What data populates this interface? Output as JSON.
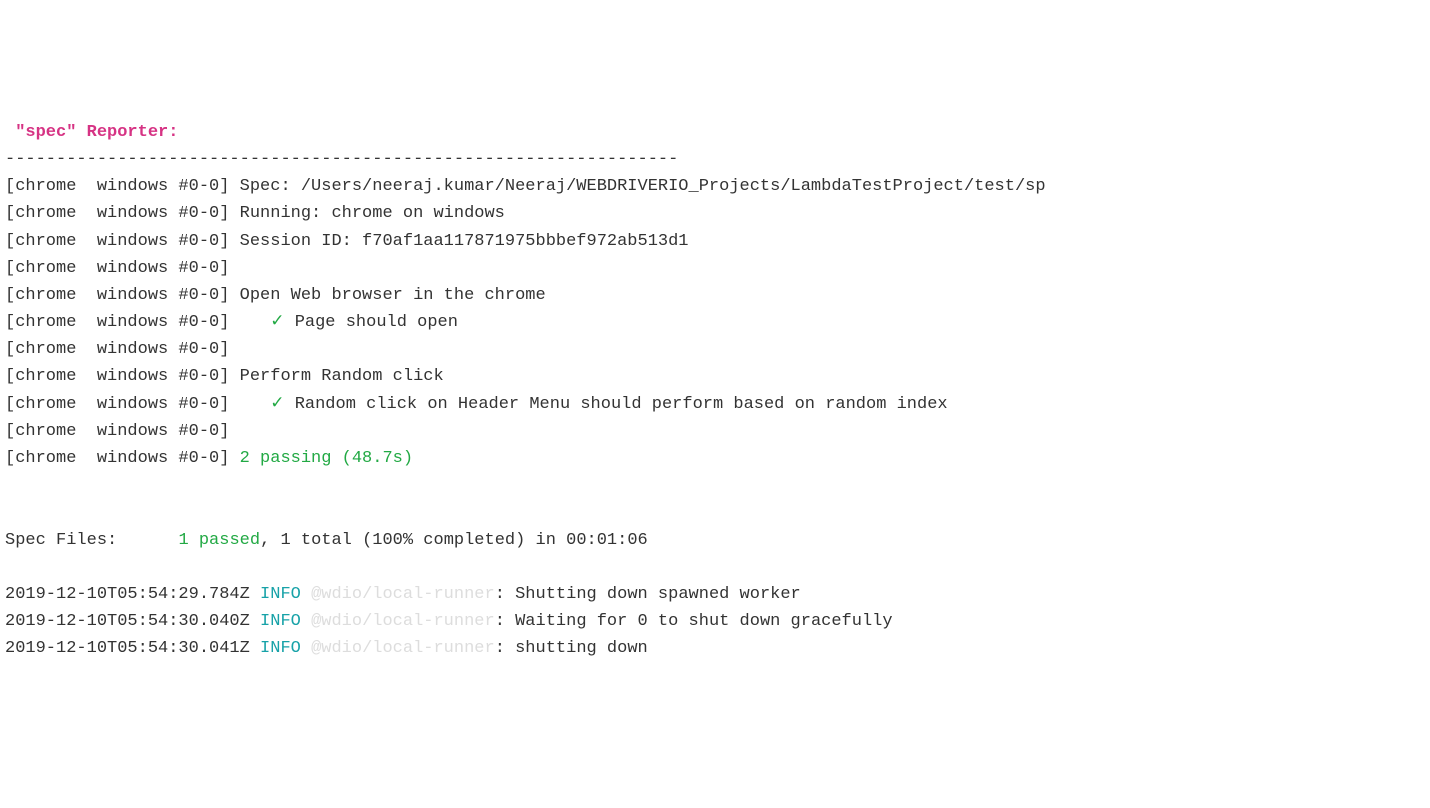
{
  "header": {
    "title": " \"spec\" Reporter:",
    "divider": "------------------------------------------------------------------"
  },
  "prefix": "[chrome  windows #0-0]",
  "lines": {
    "spec": " Spec: /Users/neeraj.kumar/Neeraj/WEBDRIVERIO_Projects/LambdaTestProject/test/sp",
    "running": " Running: chrome on windows",
    "sessionId": " Session ID: f70af1aa117871975bbbef972ab513d1",
    "empty": "",
    "suite1": " Open Web browser in the chrome",
    "test1": " Page should open",
    "suite2": " Perform Random click",
    "test2": " Random click on Header Menu should perform based on random index",
    "passing": " 2 passing (48.7s)"
  },
  "checkmark": "✓",
  "indent": "    ",
  "specFiles": {
    "label": "Spec Files:      ",
    "passed": "1 passed",
    "rest": ", 1 total (100% completed) in 00:01:06"
  },
  "logs": [
    {
      "timestamp": "2019-12-10T05:54:29.784Z ",
      "level": "INFO ",
      "source": "@wdio/local-runner",
      "message": ": Shutting down spawned worker"
    },
    {
      "timestamp": "2019-12-10T05:54:30.040Z ",
      "level": "INFO ",
      "source": "@wdio/local-runner",
      "message": ": Waiting for 0 to shut down gracefully"
    },
    {
      "timestamp": "2019-12-10T05:54:30.041Z ",
      "level": "INFO ",
      "source": "@wdio/local-runner",
      "message": ": shutting down"
    }
  ]
}
